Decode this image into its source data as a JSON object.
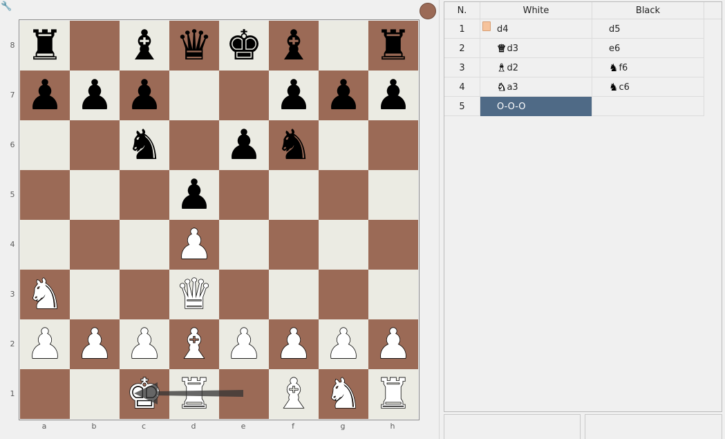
{
  "toolbar": {
    "wrench_icon": "wrench-icon"
  },
  "side_to_move_color": "#9b6a56",
  "board": {
    "files": [
      "a",
      "b",
      "c",
      "d",
      "e",
      "f",
      "g",
      "h"
    ],
    "ranks": [
      "8",
      "7",
      "6",
      "5",
      "4",
      "3",
      "2",
      "1"
    ],
    "light_color": "#ebebe3",
    "dark_color": "#9b6a56",
    "position": [
      [
        "bR",
        "",
        "bB",
        "bQ",
        "bK",
        "bB",
        "",
        "bR"
      ],
      [
        "bP",
        "bP",
        "bP",
        "",
        "",
        "bP",
        "bP",
        "bP"
      ],
      [
        "",
        "",
        "bN",
        "",
        "bP",
        "bN",
        "",
        ""
      ],
      [
        "",
        "",
        "",
        "bP",
        "",
        "",
        "",
        ""
      ],
      [
        "",
        "",
        "",
        "wP",
        "",
        "",
        "",
        ""
      ],
      [
        "wN",
        "",
        "",
        "wQ",
        "",
        "",
        "",
        ""
      ],
      [
        "wP",
        "wP",
        "wP",
        "wB",
        "wP",
        "wP",
        "wP",
        "wP"
      ],
      [
        "",
        "",
        "wK",
        "wR",
        "",
        "wB",
        "wN",
        "wR"
      ]
    ],
    "arrow": {
      "from": "e1",
      "to": "c1",
      "color": "#333333"
    }
  },
  "moves": {
    "headers": {
      "number": "N.",
      "white": "White",
      "black": "Black"
    },
    "rows": [
      {
        "n": "1",
        "white": "d4",
        "white_piece": "",
        "black": "d5",
        "black_piece": "",
        "book": true
      },
      {
        "n": "2",
        "white": "d3",
        "white_piece": "Q",
        "black": "e6",
        "black_piece": ""
      },
      {
        "n": "3",
        "white": "d2",
        "white_piece": "B",
        "black": "f6",
        "black_piece": "N"
      },
      {
        "n": "4",
        "white": "a3",
        "white_piece": "N",
        "black": "c6",
        "black_piece": "N"
      },
      {
        "n": "5",
        "white": "O-O-O",
        "white_piece": "",
        "black": "",
        "black_piece": "",
        "selected": "white"
      }
    ],
    "selected_color": "#4f6a86"
  }
}
